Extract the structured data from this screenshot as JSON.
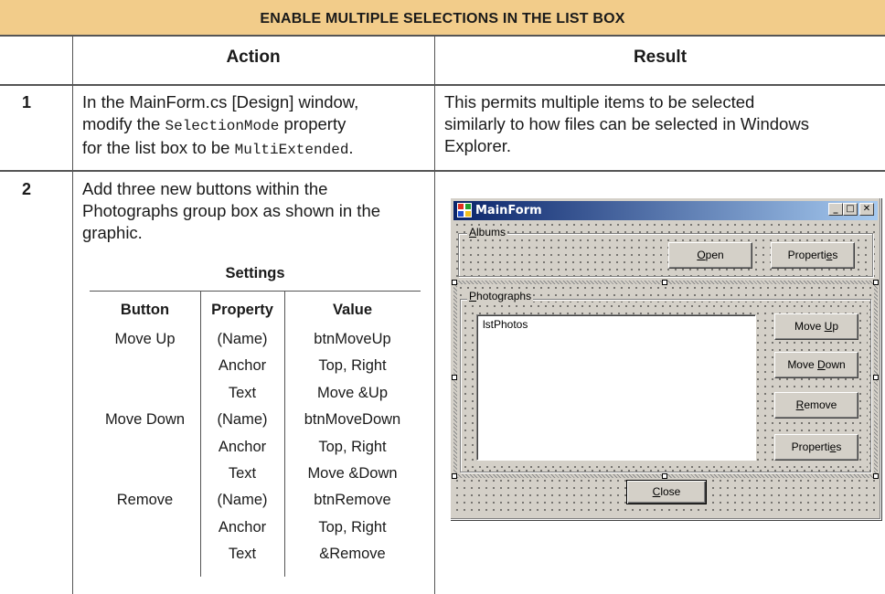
{
  "title": "Enable multiple selections in the list box",
  "headers": {
    "action": "Action",
    "result": "Result"
  },
  "steps": [
    {
      "number": "1",
      "action_line1": "In the MainForm.cs [Design] window,",
      "action_line2_pre": "modify the ",
      "action_line2_code": "SelectionMode",
      "action_line2_post": " property",
      "action_line3_pre": "for the list box to be ",
      "action_line3_code": "MultiExtended",
      "action_line3_post": ".",
      "result_line1": "This permits multiple items to be selected",
      "result_line2": "similarly to how files can be selected in Windows",
      "result_line3": "Explorer."
    },
    {
      "number": "2",
      "action_line1": "Add three new buttons within the",
      "action_line2": "Photographs group box as shown in the",
      "action_line3": "graphic."
    }
  ],
  "settings": {
    "title": "Settings",
    "columns": [
      "Button",
      "Property",
      "Value"
    ],
    "rows": [
      [
        "Move Up",
        "(Name)",
        "btnMoveUp"
      ],
      [
        "",
        "Anchor",
        "Top, Right"
      ],
      [
        "",
        "Text",
        "Move &Up"
      ],
      [
        "Move Down",
        "(Name)",
        "btnMoveDown"
      ],
      [
        "",
        "Anchor",
        "Top, Right"
      ],
      [
        "",
        "Text",
        "Move &Down"
      ],
      [
        "Remove",
        "(Name)",
        "btnRemove"
      ],
      [
        "",
        "Anchor",
        "Top, Right"
      ],
      [
        "",
        "Text",
        "&Remove"
      ]
    ]
  },
  "form": {
    "title": "MainForm",
    "caption_buttons": {
      "minimize": "_",
      "maximize": "□",
      "close": "✕"
    },
    "albums_label": "Albums",
    "albums_accel": "A",
    "albums_rest": "lbums",
    "open_accel": "O",
    "open_rest": "pen",
    "properties_pre": "Properti",
    "properties_accel": "e",
    "properties_post": "s",
    "photographs_label": "Photographs",
    "photographs_accel": "P",
    "photographs_rest": "hotographs",
    "listbox_text": "lstPhotos",
    "move_up_pre": "Move ",
    "move_up_accel": "U",
    "move_up_post": "p",
    "move_down_pre": "Move ",
    "move_down_accel": "D",
    "move_down_post": "own",
    "remove_accel": "R",
    "remove_rest": "emove",
    "close_accel": "C",
    "close_rest": "lose"
  },
  "colors": {
    "title_band": "#f2cc8a",
    "form_face": "#d4d0c8",
    "titlebar_start": "#0a246a",
    "titlebar_end": "#a6caf0"
  }
}
